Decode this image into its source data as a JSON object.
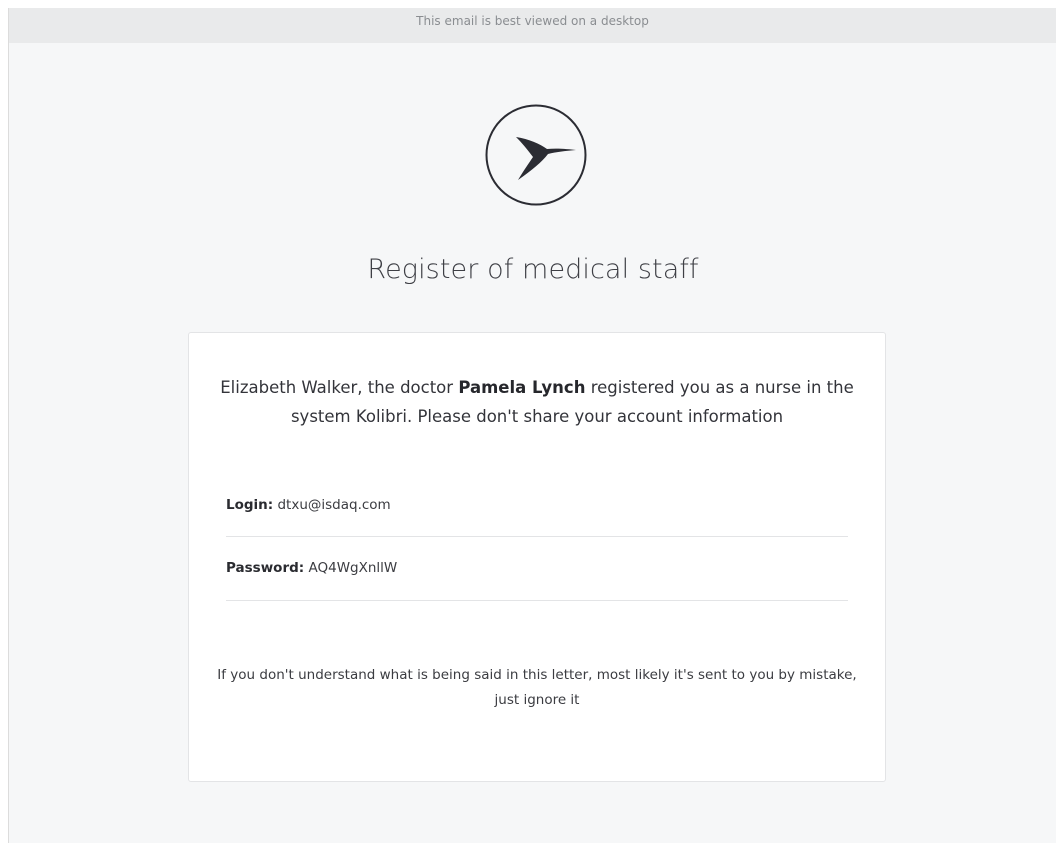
{
  "banner": {
    "text": "This email is best viewed on a desktop"
  },
  "logo": {
    "icon": "hummingbird-icon"
  },
  "title": "Register of medical staff",
  "message": {
    "intro_part1": "Elizabeth Walker, the doctor ",
    "doctor_name": "Pamela Lynch",
    "intro_part2": " registered you as a nurse in the system Kolibri. Please don't share your account information"
  },
  "credentials": {
    "login_label": "Login:",
    "login_value": "dtxu@isdaq.com",
    "password_label": "Password:",
    "password_value": "AQ4WgXnllW"
  },
  "footnote": "If you don't understand what is being said in this letter, most likely it's sent to you by mistake, just ignore it",
  "colors": {
    "background": "#f6f7f8",
    "banner": "#e9eaeb",
    "card": "#ffffff",
    "text": "#33343a",
    "logo": "#2b2c33"
  }
}
